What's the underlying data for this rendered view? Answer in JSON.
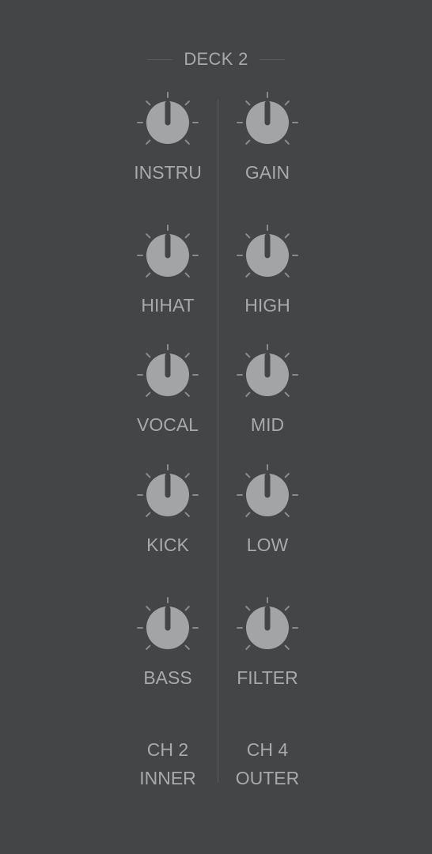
{
  "deck": {
    "title": "DECK 2"
  },
  "knobs_left": [
    {
      "label": "INSTRU",
      "icon": "knob-icon",
      "value": 0.5
    },
    {
      "label": "HIHAT",
      "icon": "knob-icon",
      "value": 0.5
    },
    {
      "label": "VOCAL",
      "icon": "knob-icon",
      "value": 0.5
    },
    {
      "label": "KICK",
      "icon": "knob-icon",
      "value": 0.5
    },
    {
      "label": "BASS",
      "icon": "knob-icon",
      "value": 0.5
    }
  ],
  "knobs_right": [
    {
      "label": "GAIN",
      "icon": "knob-icon",
      "value": 0.5
    },
    {
      "label": "HIGH",
      "icon": "knob-icon",
      "value": 0.5
    },
    {
      "label": "MID",
      "icon": "knob-icon",
      "value": 0.5
    },
    {
      "label": "LOW",
      "icon": "knob-icon",
      "value": 0.5
    },
    {
      "label": "FILTER",
      "icon": "knob-icon",
      "value": 0.5
    }
  ],
  "channels": {
    "left": {
      "line1": "CH 2",
      "line2": "INNER"
    },
    "right": {
      "line1": "CH 4",
      "line2": "OUTER"
    }
  },
  "colors": {
    "background": "#444546",
    "knob": "#a3a4a5",
    "pointer": "#444546",
    "ticks": "#8a8b8c",
    "text": "#a8a9aa"
  }
}
